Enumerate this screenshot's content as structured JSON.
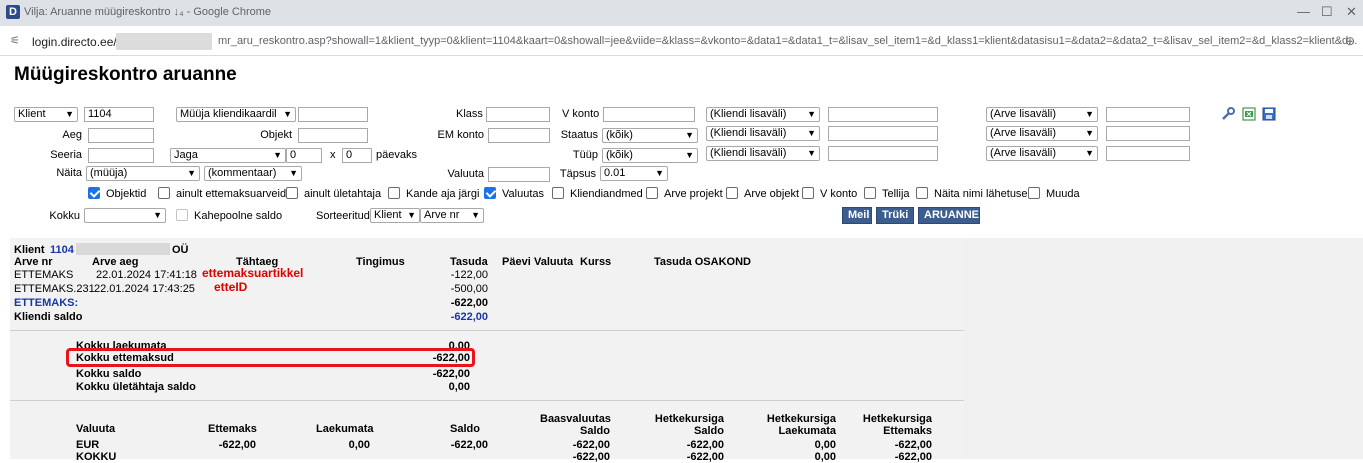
{
  "window": {
    "title": "Vilja: Aruanne müügireskontro ↓₄ - Google Chrome",
    "min_icon": "minimize-icon",
    "max_icon": "maximize-icon",
    "close_icon": "close-icon"
  },
  "address": {
    "host": "login.directo.ee/",
    "path": "mr_aru_reskontro.asp?showall=1&klient_tyyp=0&klient=1104&kaart=0&showall=jee&viide=&klass=&vkonto=&data1=&data1_t=&lisav_sel_item1=&d_klass1=klient&datasisu1=&data2=&data2_t=&lisav_sel_item2=&d_klass2=klient&d..."
  },
  "page": {
    "title": "Müügireskontro aruanne"
  },
  "filters": {
    "klient_select": "Klient",
    "klient_value": "1104",
    "myyja_select": "Müüja kliendikaardil",
    "klass_label": "Klass",
    "vkonto_label": "V konto",
    "lisavali_1": "(Kliendi lisaväli)",
    "lisavali_2": "(Kliendi lisaväli)",
    "lisavali_3": "(Kliendi lisaväli)",
    "arve_lisavali_1": "(Arve lisaväli)",
    "arve_lisavali_2": "(Arve lisaväli)",
    "arve_lisavali_3": "(Arve lisaväli)",
    "aeg_label": "Aeg",
    "objekt_label": "Objekt",
    "em_konto_label": "EM konto",
    "staatus_label": "Staatus",
    "staatus_value": "(kõik)",
    "seeria_label": "Seeria",
    "jaga_value": "Jaga",
    "jaga_num": "0",
    "x_label": "x",
    "x_value": "0",
    "paevaks_label": "päevaks",
    "tyyp_label": "Tüüp",
    "tyyp_value": "(kõik)",
    "naita_label": "Näita",
    "naita_value": "(müüja)",
    "kommentaar_value": "(kommentaar)",
    "valuuta_label": "Valuuta",
    "tapsus_label": "Täpsus",
    "tapsus_value": "0.01",
    "kokku_label": "Kokku",
    "kahepoolne_label": "Kahepoolne saldo",
    "sorteeritud_label": "Sorteeritud",
    "sort1": "Klient",
    "sort2": "Arve nr"
  },
  "checkboxes": [
    {
      "label": "Objektid",
      "checked": true
    },
    {
      "label": "ainult ettemaksuarveid",
      "checked": false
    },
    {
      "label": "ainult ületahtaja",
      "checked": false
    },
    {
      "label": "Kande aja järgi",
      "checked": false
    },
    {
      "label": "Valuutas",
      "checked": true
    },
    {
      "label": "Kliendiandmed",
      "checked": false
    },
    {
      "label": "Arve projekt",
      "checked": false
    },
    {
      "label": "Arve objekt",
      "checked": false
    },
    {
      "label": "V konto",
      "checked": false
    },
    {
      "label": "Tellija",
      "checked": false
    },
    {
      "label": "Näita nimi lähetusel",
      "checked": false
    },
    {
      "label": "Muuda",
      "checked": false
    }
  ],
  "buttons": {
    "meil": "Meil",
    "tryki": "Trüki",
    "aruanne": "ARUANNE"
  },
  "tools": [
    "wrench-icon",
    "excel-icon",
    "save-icon"
  ],
  "report": {
    "client_prefix": "Klient",
    "client_id": "1104",
    "client_suffix": "OÜ",
    "headers": {
      "arve_nr": "Arve nr",
      "arve_aeg": "Arve aeg",
      "tahtaeg": "Tähtaeg",
      "tingimus": "Tingimus",
      "tasuda": "Tasuda",
      "paevi": "Päevi",
      "valuuta": "Valuuta",
      "kurss": "Kurss",
      "tasuda_osakond": "Tasuda OSAKOND"
    },
    "rows": [
      {
        "arve_nr": "ETTEMAKS",
        "arve_aeg": "22.01.2024 17:41:18",
        "note": "ettemaksuartikkel",
        "tasuda": "-122,00"
      },
      {
        "arve_nr": "ETTEMAKS.231",
        "arve_aeg": "22.01.2024 17:43:25",
        "note": "etteID",
        "tasuda": "-500,00"
      }
    ],
    "ettemaks_label": "ETTEMAKS:",
    "ettemaks_total": "-622,00",
    "kliendi_saldo_label": "Kliendi saldo",
    "kliendi_saldo_value": "-622,00",
    "summary": [
      {
        "label": "Kokku laekumata",
        "value": "0,00"
      },
      {
        "label": "Kokku ettemaksud",
        "value": "-622,00"
      },
      {
        "label": "Kokku saldo",
        "value": "-622,00"
      },
      {
        "label": "Kokku ületähtaja saldo",
        "value": "0,00"
      }
    ],
    "currency_headers": {
      "valuuta": "Valuuta",
      "ettemaks": "Ettemaks",
      "laekumata": "Laekumata",
      "saldo": "Saldo",
      "baas_l1": "Baasvaluutas",
      "baas_l2": "Saldo",
      "hk1_l1": "Hetkekursiga",
      "hk1_l2": "Saldo",
      "hk2_l1": "Hetkekursiga",
      "hk2_l2": "Laekumata",
      "hk3_l1": "Hetkekursiga",
      "hk3_l2": "Ettemaks"
    },
    "currency_rows": [
      {
        "valuuta": "EUR",
        "ettemaks": "-622,00",
        "laekumata": "0,00",
        "saldo": "-622,00",
        "baas_saldo": "-622,00",
        "hk_saldo": "-622,00",
        "hk_laekumata": "0,00",
        "hk_ettemaks": "-622,00"
      },
      {
        "valuuta": "KOKKU",
        "baas_saldo": "-622,00",
        "hk_saldo": "-622,00",
        "hk_laekumata": "0,00",
        "hk_ettemaks": "-622,00"
      }
    ]
  }
}
